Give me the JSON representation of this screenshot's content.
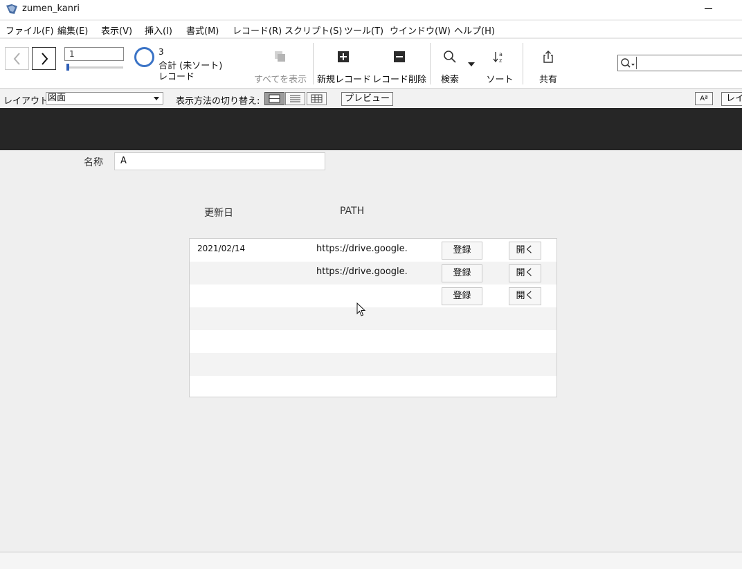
{
  "window": {
    "title": "zumen_kanri"
  },
  "menu": [
    "ファイル(F)",
    "編集(E)",
    "表示(V)",
    "挿入(I)",
    "書式(M)",
    "レコード(R)",
    "スクリプト(S)",
    "ツール(T)",
    "ウインドウ(W)",
    "ヘルプ(H)"
  ],
  "toolbar": {
    "record_number": "1",
    "record_count": "3",
    "total_label": "合計 (未ソート)",
    "record_unit": "レコード",
    "show_all": "すべてを表示",
    "new_record": "新規レコード",
    "delete_record": "レコード削除",
    "find": "検索",
    "sort": "ソート",
    "share": "共有",
    "search_placeholder": ""
  },
  "layout_bar": {
    "layout_label": "レイアウト:",
    "layout_value": "図面",
    "view_as_label": "表示方法の切り替え:",
    "preview": "プレビュー",
    "aa": "Aª",
    "layout_btn": "レイ"
  },
  "form": {
    "name_label": "名称",
    "name_value": "A",
    "col_updated": "更新日",
    "col_path": "PATH",
    "rows": [
      {
        "date": "2021/02/14",
        "path": "https://drive.google.",
        "register": "登録",
        "open": "開く"
      },
      {
        "date": "",
        "path": "https://drive.google.",
        "register": "登録",
        "open": "開く"
      },
      {
        "date": "",
        "path": "",
        "register": "登録",
        "open": "開く"
      }
    ]
  },
  "colors": {
    "accent": "#3a73c6",
    "header_band": "#262626",
    "background": "#efefef"
  }
}
